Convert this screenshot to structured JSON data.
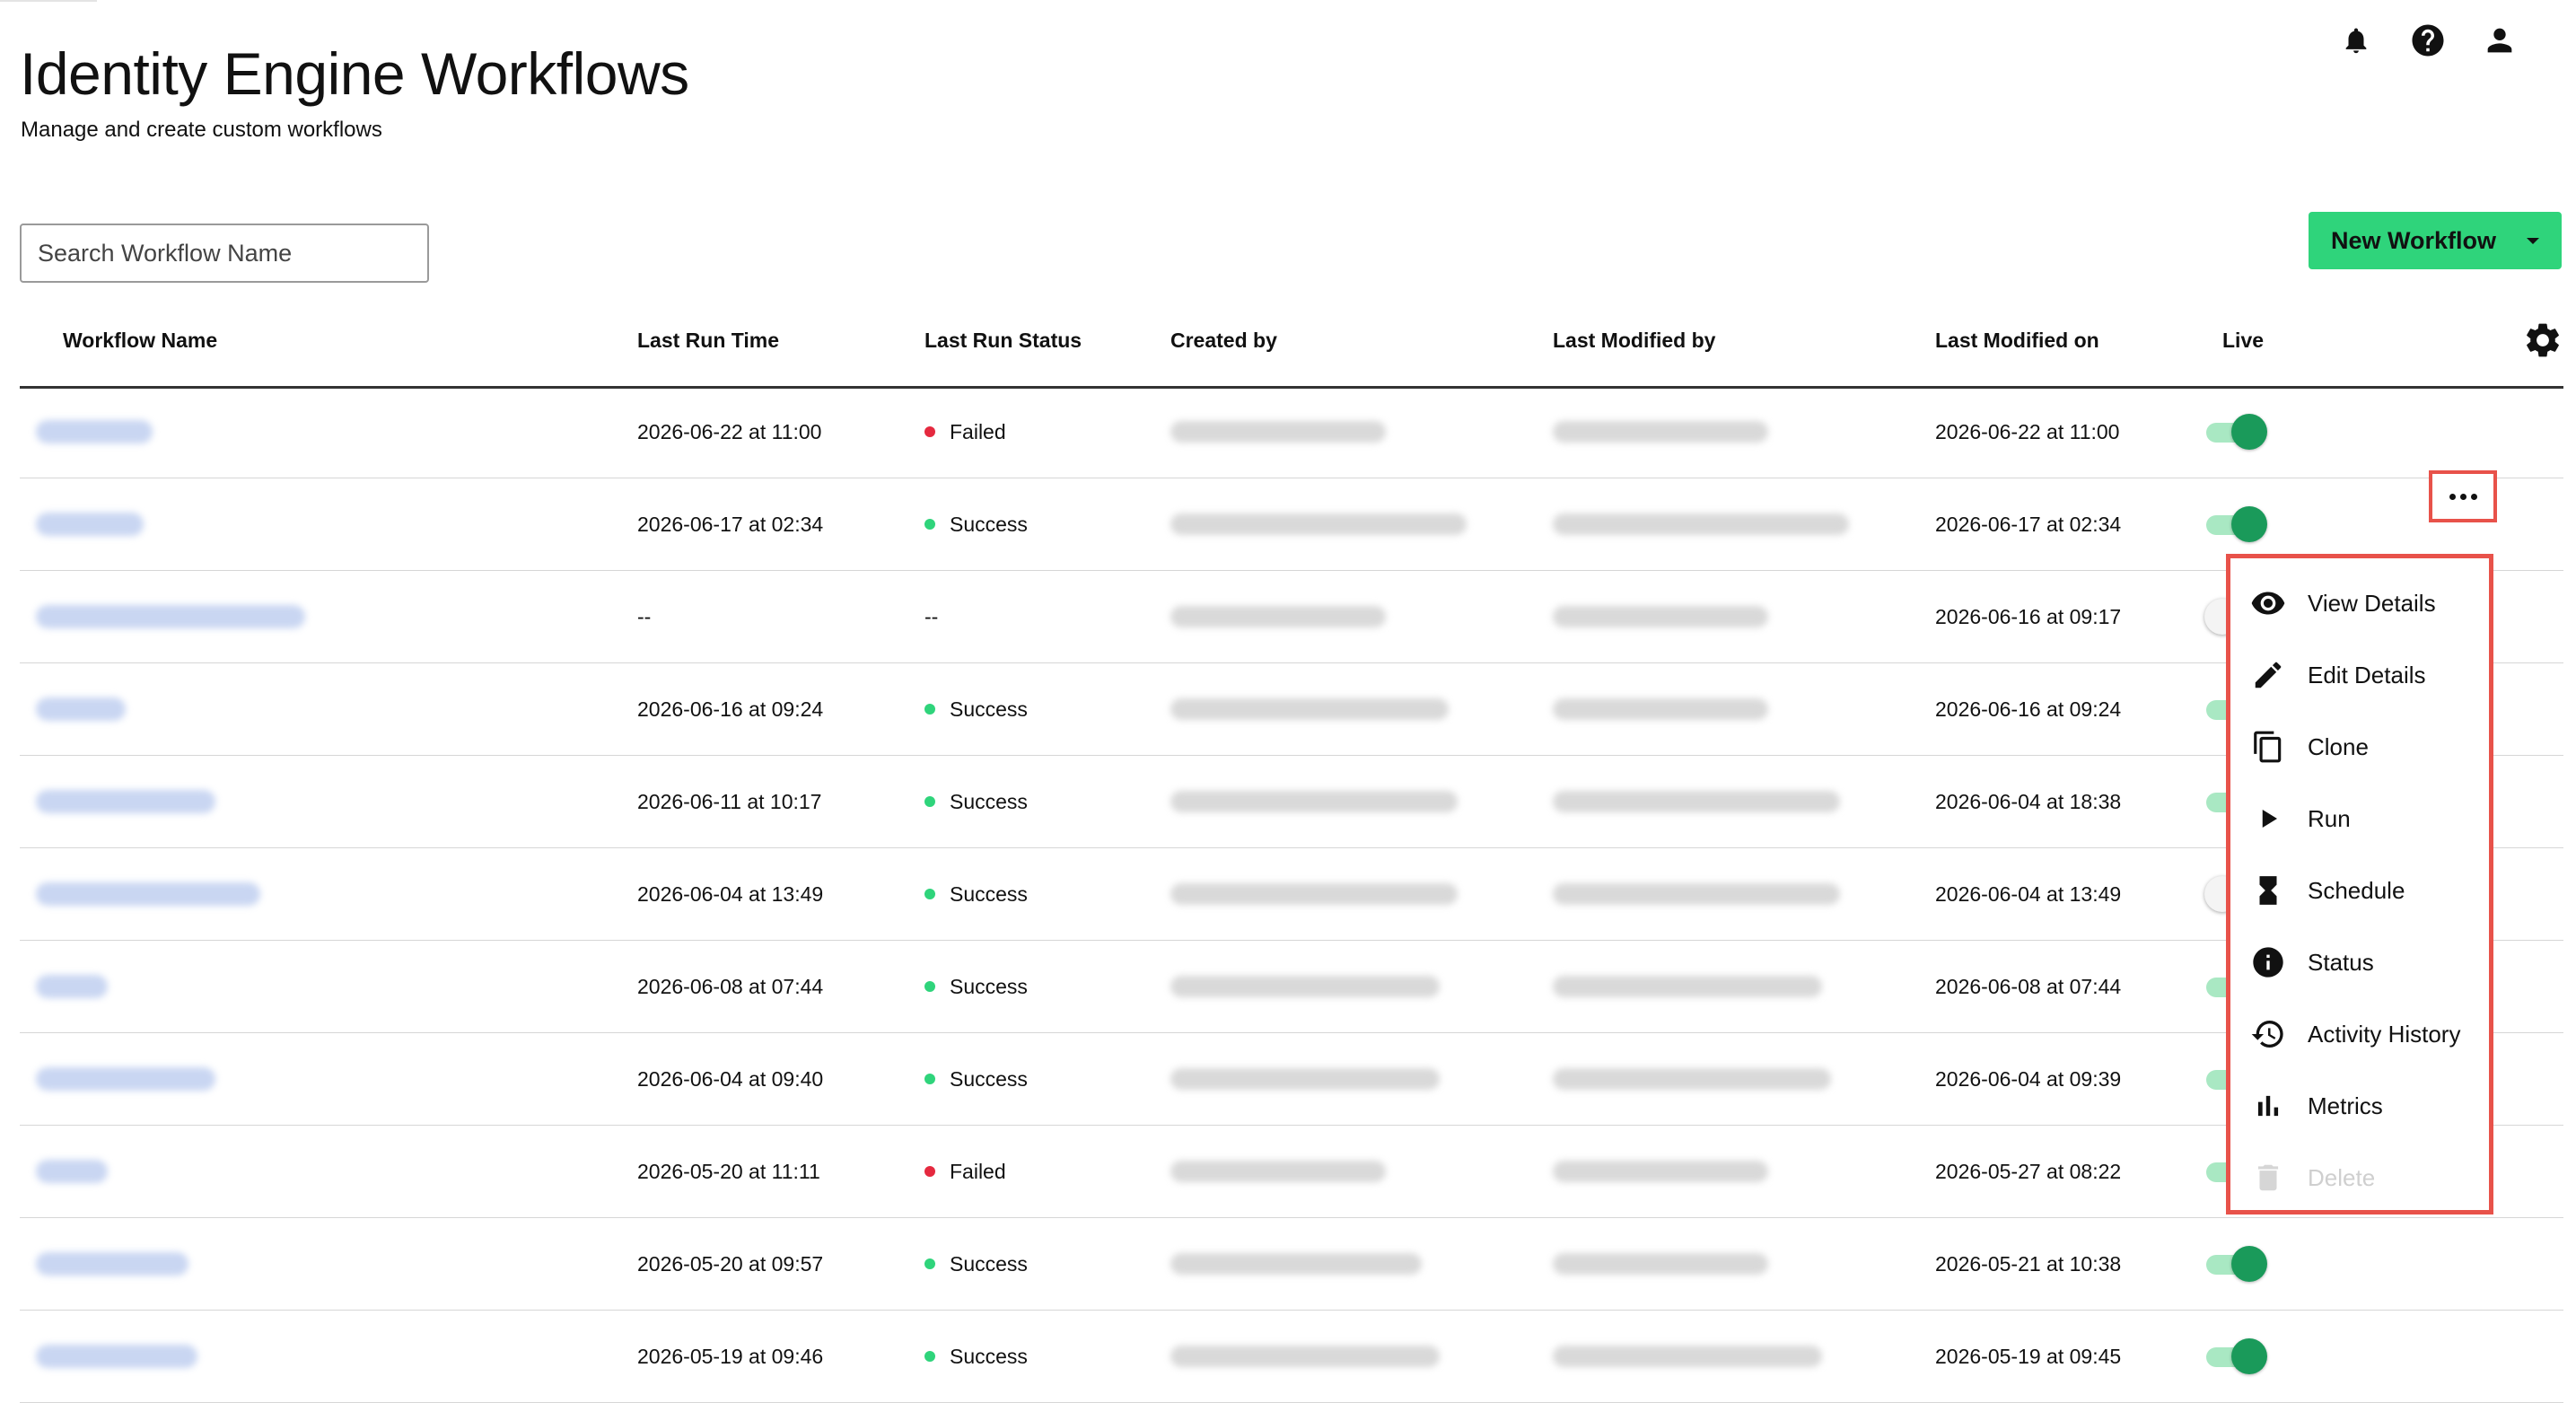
{
  "header": {
    "title": "Identity Engine Workflows",
    "subtitle": "Manage and create custom workflows",
    "icons": [
      "bell-icon",
      "help-icon",
      "account-icon"
    ]
  },
  "search": {
    "placeholder": "Search Workflow Name",
    "value": ""
  },
  "new_workflow_button": {
    "label": "New Workflow"
  },
  "table": {
    "columns": [
      "Workflow Name",
      "Last Run Time",
      "Last Run Status",
      "Created by",
      "Last Modified by",
      "Last Modified on",
      "Live"
    ],
    "rows": [
      {
        "last_run_time": "2026-06-22 at 11:00",
        "status": "Failed",
        "last_modified_on": "2026-06-22 at 11:00",
        "live": true
      },
      {
        "last_run_time": "2026-06-17 at 02:34",
        "status": "Success",
        "last_modified_on": "2026-06-17 at 02:34",
        "live": true
      },
      {
        "last_run_time": "--",
        "status": "--",
        "last_modified_on": "2026-06-16 at 09:17",
        "live": false
      },
      {
        "last_run_time": "2026-06-16 at 09:24",
        "status": "Success",
        "last_modified_on": "2026-06-16 at 09:24",
        "live": true
      },
      {
        "last_run_time": "2026-06-11 at 10:17",
        "status": "Success",
        "last_modified_on": "2026-06-04 at 18:38",
        "live": true
      },
      {
        "last_run_time": "2026-06-04 at 13:49",
        "status": "Success",
        "last_modified_on": "2026-06-04 at 13:49",
        "live": false
      },
      {
        "last_run_time": "2026-06-08 at 07:44",
        "status": "Success",
        "last_modified_on": "2026-06-08 at 07:44",
        "live": true
      },
      {
        "last_run_time": "2026-06-04 at 09:40",
        "status": "Success",
        "last_modified_on": "2026-06-04 at 09:39",
        "live": true
      },
      {
        "last_run_time": "2026-05-20 at 11:11",
        "status": "Failed",
        "last_modified_on": "2026-05-27 at 08:22",
        "live": true
      },
      {
        "last_run_time": "2026-05-20 at 09:57",
        "status": "Success",
        "last_modified_on": "2026-05-21 at 10:38",
        "live": true
      },
      {
        "last_run_time": "2026-05-19 at 09:46",
        "status": "Success",
        "last_modified_on": "2026-05-19 at 09:45",
        "live": true
      }
    ]
  },
  "status_colors": {
    "Failed": "#e5293f",
    "Success": "#2fd47b"
  },
  "row_menu": {
    "items": [
      {
        "label": "View Details",
        "icon": "eye-icon",
        "disabled": false
      },
      {
        "label": "Edit Details",
        "icon": "pencil-icon",
        "disabled": false
      },
      {
        "label": "Clone",
        "icon": "copy-icon",
        "disabled": false
      },
      {
        "label": "Run",
        "icon": "play-icon",
        "disabled": false
      },
      {
        "label": "Schedule",
        "icon": "hourglass-icon",
        "disabled": false
      },
      {
        "label": "Status",
        "icon": "info-icon",
        "disabled": false
      },
      {
        "label": "Activity History",
        "icon": "history-icon",
        "disabled": false
      },
      {
        "label": "Metrics",
        "icon": "bar-chart-icon",
        "disabled": false
      },
      {
        "label": "Delete",
        "icon": "trash-icon",
        "disabled": true
      }
    ]
  },
  "colors": {
    "accent": "#2fd47b",
    "highlight": "#e8524a",
    "toggle_on": "#1a9a5a"
  }
}
